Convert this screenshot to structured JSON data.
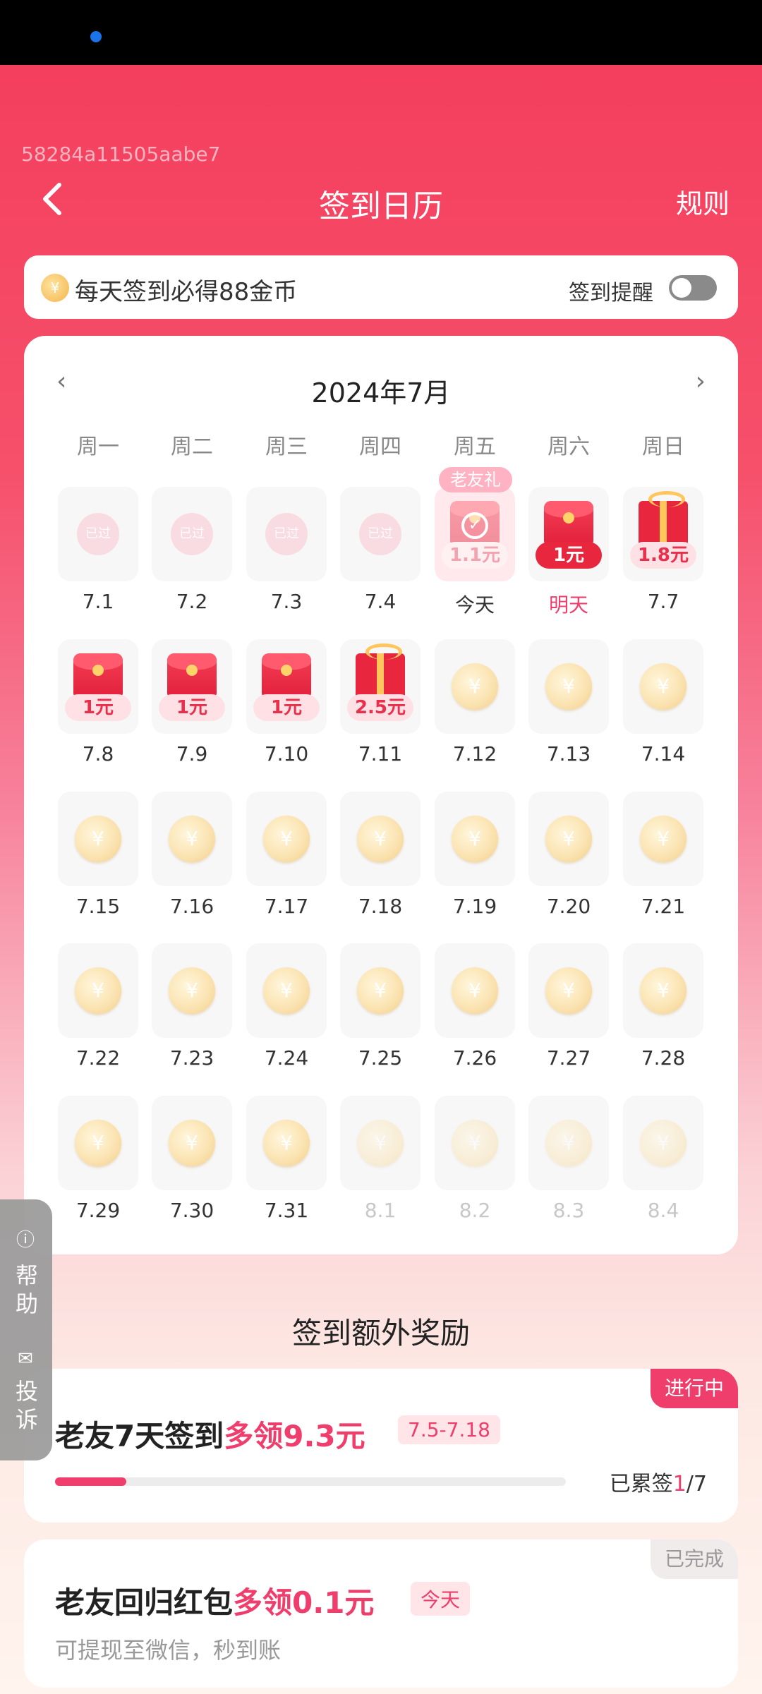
{
  "debug_id": "58284a11505aabe7",
  "header": {
    "title": "签到日历",
    "rules": "规则"
  },
  "banner": {
    "text": "每天签到必得88金币",
    "remind": "签到提醒",
    "coin_symbol": "¥"
  },
  "calendar": {
    "month": "2024年7月",
    "prev": "‹",
    "next": "›",
    "weekdays": [
      "周一",
      "周二",
      "周三",
      "周四",
      "周五",
      "周六",
      "周日"
    ],
    "days": [
      {
        "date": "7.1",
        "kind": "passed",
        "badge": "已过"
      },
      {
        "date": "7.2",
        "kind": "passed",
        "badge": "已过"
      },
      {
        "date": "7.3",
        "kind": "passed",
        "badge": "已过"
      },
      {
        "date": "7.4",
        "kind": "passed",
        "badge": "已过"
      },
      {
        "date": "今天",
        "kind": "today",
        "tag": "老友礼",
        "amount": "1.1元"
      },
      {
        "date": "明天",
        "kind": "envelope",
        "amount": "1元",
        "tomorrow": true
      },
      {
        "date": "7.7",
        "kind": "gift",
        "amount": "1.8元"
      },
      {
        "date": "7.8",
        "kind": "envelope",
        "amount": "1元"
      },
      {
        "date": "7.9",
        "kind": "envelope",
        "amount": "1元"
      },
      {
        "date": "7.10",
        "kind": "envelope",
        "amount": "1元"
      },
      {
        "date": "7.11",
        "kind": "gift",
        "amount": "2.5元"
      },
      {
        "date": "7.12",
        "kind": "coin"
      },
      {
        "date": "7.13",
        "kind": "coin"
      },
      {
        "date": "7.14",
        "kind": "coin"
      },
      {
        "date": "7.15",
        "kind": "coin"
      },
      {
        "date": "7.16",
        "kind": "coin"
      },
      {
        "date": "7.17",
        "kind": "coin"
      },
      {
        "date": "7.18",
        "kind": "coin"
      },
      {
        "date": "7.19",
        "kind": "coin"
      },
      {
        "date": "7.20",
        "kind": "coin"
      },
      {
        "date": "7.21",
        "kind": "coin"
      },
      {
        "date": "7.22",
        "kind": "coin"
      },
      {
        "date": "7.23",
        "kind": "coin"
      },
      {
        "date": "7.24",
        "kind": "coin"
      },
      {
        "date": "7.25",
        "kind": "coin"
      },
      {
        "date": "7.26",
        "kind": "coin"
      },
      {
        "date": "7.27",
        "kind": "coin"
      },
      {
        "date": "7.28",
        "kind": "coin"
      },
      {
        "date": "7.29",
        "kind": "coin"
      },
      {
        "date": "7.30",
        "kind": "coin"
      },
      {
        "date": "7.31",
        "kind": "coin"
      },
      {
        "date": "8.1",
        "kind": "coin",
        "future": true
      },
      {
        "date": "8.2",
        "kind": "coin",
        "future": true
      },
      {
        "date": "8.3",
        "kind": "coin",
        "future": true
      },
      {
        "date": "8.4",
        "kind": "coin",
        "future": true
      }
    ]
  },
  "extra": {
    "section_title": "签到额外奖励",
    "streak": {
      "title_main": "老友7天签到",
      "title_em": "多领9.3元",
      "range": "7.5-7.18",
      "status": "进行中",
      "progress_label": "已累签",
      "progress_done": "1",
      "progress_total": "/7",
      "progress_fraction": 0.14
    },
    "return_gift": {
      "title_main": "老友回归红包",
      "title_em": "多领0.1元",
      "range": "今天",
      "status": "已完成",
      "subtitle": "可提现至微信，秒到账"
    }
  },
  "side_help": {
    "help": "帮助",
    "complain": "投诉"
  },
  "colors": {
    "accent": "#ef3e6c",
    "header_bg": "#f43f5e"
  }
}
